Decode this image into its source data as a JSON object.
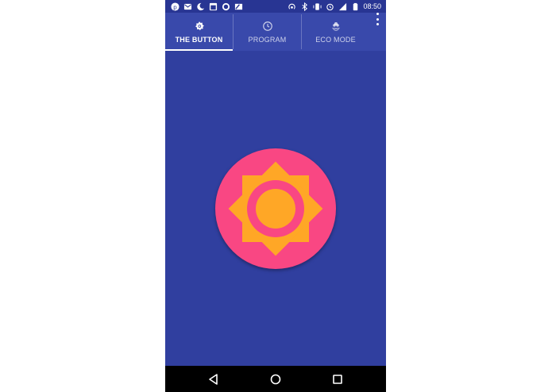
{
  "status_bar": {
    "time": "08:50",
    "left_icons": [
      "pinterest-icon",
      "gmail-icon",
      "moon-icon",
      "calendar-icon",
      "whatsapp-icon",
      "maps-icon"
    ],
    "right_icons": [
      "hotspot-icon",
      "bluetooth-icon",
      "vibrate-icon",
      "alarm-icon",
      "signal-icon",
      "battery-icon"
    ]
  },
  "tabs": [
    {
      "label": "THE BUTTON",
      "icon": "brightness-icon",
      "active": true
    },
    {
      "label": "PROGRAM",
      "icon": "clock-icon",
      "active": false
    },
    {
      "label": "ECO MODE",
      "icon": "eco-flower-icon",
      "active": false
    }
  ],
  "colors": {
    "background": "#303f9f",
    "tab_bar": "#3949ab",
    "status_bar": "#283593",
    "button_circle": "#f94783",
    "sun": "#ffa726"
  }
}
